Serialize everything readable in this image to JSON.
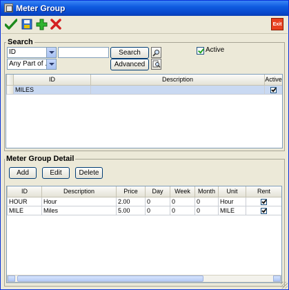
{
  "window": {
    "title": "Meter Group"
  },
  "toolbar": {
    "icons": [
      "checkmark-icon",
      "save-icon",
      "plus-icon",
      "delete-icon"
    ],
    "exit_label": "Exit"
  },
  "search": {
    "group_label": "Search",
    "field_select": "ID",
    "match_select": "Any Part of ...",
    "query_value": "",
    "search_button": "Search",
    "advanced_button": "Advanced",
    "active_label": "Active",
    "active_checked": true
  },
  "results_grid": {
    "columns": [
      "ID",
      "Description",
      "Active"
    ],
    "rows": [
      {
        "id": "MILES",
        "description": "",
        "active": true
      }
    ]
  },
  "detail": {
    "group_label": "Meter Group Detail",
    "add_button": "Add",
    "edit_button": "Edit",
    "delete_button": "Delete",
    "columns": [
      "ID",
      "Description",
      "Price",
      "Day",
      "Week",
      "Month",
      "Unit",
      "Rent"
    ],
    "rows": [
      {
        "id": "HOUR",
        "description": "Hour",
        "price": "2.00",
        "day": "0",
        "week": "0",
        "month": "0",
        "unit": "Hour",
        "rent": true
      },
      {
        "id": "MILE",
        "description": "Miles",
        "price": "5.00",
        "day": "0",
        "week": "0",
        "month": "0",
        "unit": "MILE",
        "rent": true
      }
    ]
  },
  "colors": {
    "titlebar": "#0a50d8",
    "window_bg": "#ece9d8",
    "selection": "#c9d9f2",
    "exit_button": "#e8401e"
  }
}
